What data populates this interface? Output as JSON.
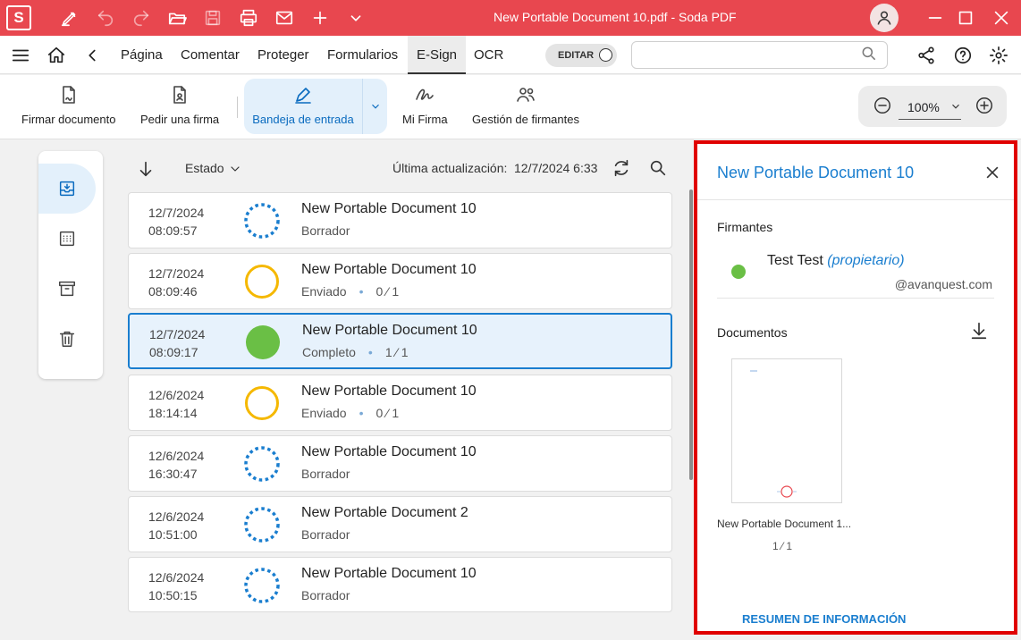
{
  "window": {
    "title": "New Portable Document 10.pdf  -  Soda PDF",
    "logo_letter": "S"
  },
  "menu": {
    "tabs": [
      "Página",
      "Comentar",
      "Proteger",
      "Formularios",
      "E-Sign",
      "OCR"
    ],
    "active_tab": "E-Sign",
    "edit_label": "EDITAR",
    "search_value": ""
  },
  "ribbon": {
    "buttons": [
      "Firmar documento",
      "Pedir una firma",
      "Bandeja de entrada",
      "Mi Firma",
      "Gestión de firmantes"
    ],
    "active": "Bandeja de entrada",
    "zoom": "100%"
  },
  "list": {
    "sort_label": "Estado",
    "last_update_label": "Última actualización:",
    "last_update_value": "12/7/2024 6:33",
    "rows": [
      {
        "date": "12/7/2024",
        "time": "08:09:57",
        "name": "New Portable Document 10",
        "status": "Borrador",
        "progress": "",
        "state": "draft"
      },
      {
        "date": "12/7/2024",
        "time": "08:09:46",
        "name": "New Portable Document 10",
        "status": "Enviado",
        "progress": "0 ⁄ 1",
        "state": "sent"
      },
      {
        "date": "12/7/2024",
        "time": "08:09:17",
        "name": "New Portable Document 10",
        "status": "Completo",
        "progress": "1 ⁄ 1",
        "state": "complete"
      },
      {
        "date": "12/6/2024",
        "time": "18:14:14",
        "name": "New Portable Document 10",
        "status": "Enviado",
        "progress": "0 ⁄ 1",
        "state": "sent"
      },
      {
        "date": "12/6/2024",
        "time": "16:30:47",
        "name": "New Portable Document 10",
        "status": "Borrador",
        "progress": "",
        "state": "draft"
      },
      {
        "date": "12/6/2024",
        "time": "10:51:00",
        "name": "New Portable Document 2",
        "status": "Borrador",
        "progress": "",
        "state": "draft"
      },
      {
        "date": "12/6/2024",
        "time": "10:50:15",
        "name": "New Portable Document 10",
        "status": "Borrador",
        "progress": "",
        "state": "draft"
      }
    ]
  },
  "panel": {
    "title": "New Portable Document 10",
    "signers_heading": "Firmantes",
    "signer_name": "Test Test",
    "signer_role": "(propietario)",
    "signer_email": "@avanquest.com",
    "documents_heading": "Documentos",
    "doc_caption": "New Portable Document 1...",
    "doc_pages": "1 ⁄ 1",
    "summary_label": "RESUMEN DE INFORMACIÓN"
  },
  "colors": {
    "brand": "#e8474f",
    "accent": "#1a7ecf",
    "complete": "#6abf45",
    "sent": "#f5b800",
    "draft": "#1a7ecf",
    "highlight": "#e00000"
  }
}
